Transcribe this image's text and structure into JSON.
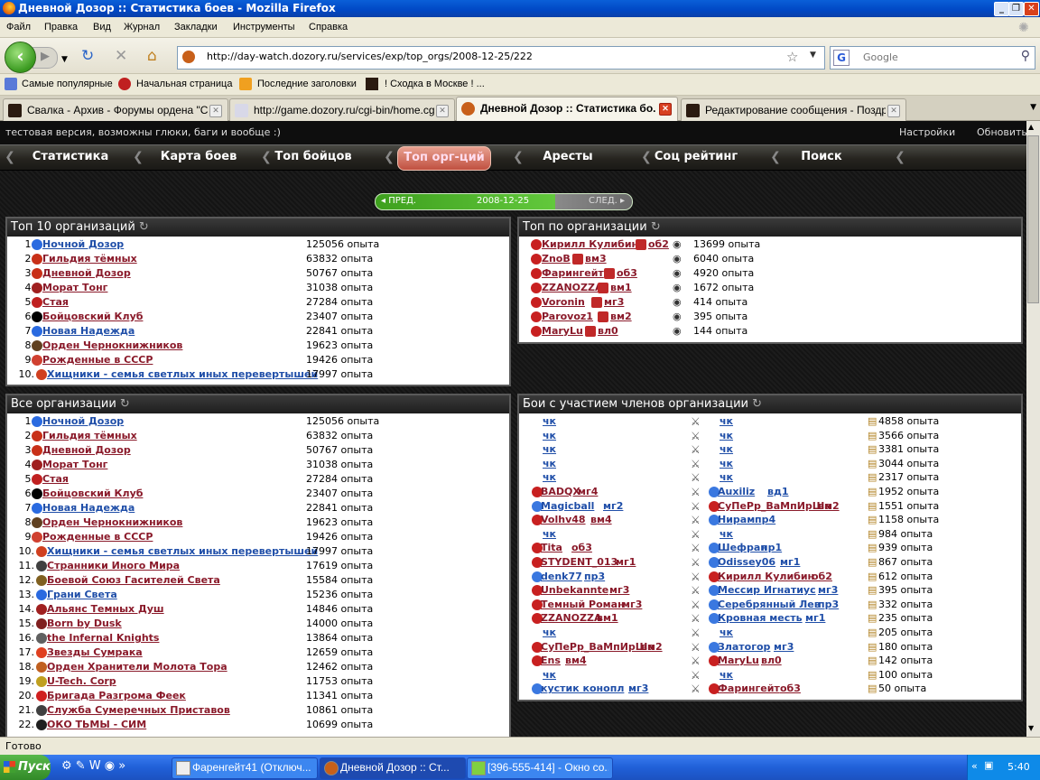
{
  "window": {
    "title": "Дневной Дозор :: Статистика боев - Mozilla Firefox"
  },
  "menu": [
    "Файл",
    "Правка",
    "Вид",
    "Журнал",
    "Закладки",
    "Инструменты",
    "Справка"
  ],
  "toolbar": {
    "url": "http://day-watch.dozory.ru/services/exp/top_orgs/2008-12-25/222",
    "search_placeholder": "Google"
  },
  "bookmarks": [
    "Самые популярные",
    "Начальная страница",
    "Последние заголовки",
    "! Сходка в Москве ! ..."
  ],
  "tabs": [
    {
      "label": "Свалка - Архив - Форумы ордена \"Ст..."
    },
    {
      "label": "http://game.dozory.ru/cgi-bin/home.cgi"
    },
    {
      "label": "Дневной Дозор :: Статистика бо..."
    },
    {
      "label": "Редактирование сообщения - Поздр..."
    }
  ],
  "site": {
    "notice": "тестовая версия, возможны глюки, баги и вообще :)",
    "settings": "Настройки",
    "refresh": "Обновить",
    "menu": [
      "Статистика",
      "Карта боев",
      "Топ бойцов",
      "Топ орг-ций",
      "Аресты",
      "Соц рейтинг",
      "Поиск"
    ],
    "date_nav": {
      "prev": "ПРЕД.",
      "date": "2008-12-25",
      "next": "СЛЕД."
    }
  },
  "top10": {
    "title": "Топ 10 организаций",
    "rows": [
      {
        "n": "1.",
        "name": "Ночной Дозор",
        "exp": "125056 опыта",
        "side": "blue",
        "color": "#2a6ae0"
      },
      {
        "n": "2.",
        "name": "Гильдия тёмных",
        "exp": "63832 опыта",
        "side": "red",
        "color": "#c83018"
      },
      {
        "n": "3.",
        "name": "Дневной Дозор",
        "exp": "50767 опыта",
        "side": "red",
        "color": "#c83018"
      },
      {
        "n": "4.",
        "name": "Морат Тонг",
        "exp": "31038 опыта",
        "side": "red",
        "color": "#a02020"
      },
      {
        "n": "5.",
        "name": "Стая",
        "exp": "27284 опыта",
        "side": "red",
        "color": "#c02020"
      },
      {
        "n": "6.",
        "name": "Бойцовский Клуб",
        "exp": "23407 опыта",
        "side": "red",
        "color": "#000000"
      },
      {
        "n": "7.",
        "name": "Новая Надежда",
        "exp": "22841 опыта",
        "side": "blue",
        "color": "#2a6ae0"
      },
      {
        "n": "8.",
        "name": "Орден Чернокнижников",
        "exp": "19623 опыта",
        "side": "red",
        "color": "#604020"
      },
      {
        "n": "9.",
        "name": "Рожденные в СССР",
        "exp": "19426 опыта",
        "side": "red",
        "color": "#d04030"
      },
      {
        "n": "10.",
        "name": "Хищники - семья светлых иных перевертышей",
        "exp": "17997 опыта",
        "side": "blue",
        "color": "#d04020"
      }
    ]
  },
  "top_by_org": {
    "title": "Топ по организации",
    "rows": [
      {
        "name": "Кирилл Кулибин",
        "lvl": "об2",
        "exp": "13699 опыта"
      },
      {
        "name": "ZnoB",
        "lvl": "вм3",
        "exp": "6040 опыта"
      },
      {
        "name": "Фарингейт",
        "lvl": "об3",
        "exp": "4920 опыта"
      },
      {
        "name": "ZZANOZZA",
        "lvl": "вм1",
        "exp": "1672 опыта"
      },
      {
        "name": "Voronin",
        "lvl": "мг3",
        "exp": "414 опыта"
      },
      {
        "name": "Parovoz1",
        "lvl": "вм2",
        "exp": "395 опыта"
      },
      {
        "name": "MaryLu",
        "lvl": "вл0",
        "exp": "144 опыта"
      }
    ]
  },
  "all_orgs": {
    "title": "Все организации",
    "rows": [
      {
        "n": "1.",
        "name": "Ночной Дозор",
        "exp": "125056 опыта",
        "side": "blue",
        "color": "#2a6ae0"
      },
      {
        "n": "2.",
        "name": "Гильдия тёмных",
        "exp": "63832 опыта",
        "side": "red",
        "color": "#c83018"
      },
      {
        "n": "3.",
        "name": "Дневной Дозор",
        "exp": "50767 опыта",
        "side": "red",
        "color": "#c83018"
      },
      {
        "n": "4.",
        "name": "Морат Тонг",
        "exp": "31038 опыта",
        "side": "red",
        "color": "#a02020"
      },
      {
        "n": "5.",
        "name": "Стая",
        "exp": "27284 опыта",
        "side": "red",
        "color": "#c02020"
      },
      {
        "n": "6.",
        "name": "Бойцовский Клуб",
        "exp": "23407 опыта",
        "side": "red",
        "color": "#000000"
      },
      {
        "n": "7.",
        "name": "Новая Надежда",
        "exp": "22841 опыта",
        "side": "blue",
        "color": "#2a6ae0"
      },
      {
        "n": "8.",
        "name": "Орден Чернокнижников",
        "exp": "19623 опыта",
        "side": "red",
        "color": "#604020"
      },
      {
        "n": "9.",
        "name": "Рожденные в СССР",
        "exp": "19426 опыта",
        "side": "red",
        "color": "#d04030"
      },
      {
        "n": "10.",
        "name": "Хищники - семья светлых иных перевертышей",
        "exp": "17997 опыта",
        "side": "blue",
        "color": "#d04020"
      },
      {
        "n": "11.",
        "name": "Странники Иного Мира",
        "exp": "17619 опыта",
        "side": "red",
        "color": "#404040"
      },
      {
        "n": "12.",
        "name": "Боевой Союз Гасителей Света",
        "exp": "15584 опыта",
        "side": "red",
        "color": "#806020"
      },
      {
        "n": "13.",
        "name": "Грани Света",
        "exp": "15236 опыта",
        "side": "blue",
        "color": "#2a6ae0"
      },
      {
        "n": "14.",
        "name": "Альянс Темных Душ",
        "exp": "14846 опыта",
        "side": "red",
        "color": "#a02020"
      },
      {
        "n": "15.",
        "name": "Born by Dusk",
        "exp": "14000 опыта",
        "side": "red",
        "color": "#802020"
      },
      {
        "n": "16.",
        "name": "the Infernal Knights",
        "exp": "13864 опыта",
        "side": "red",
        "color": "#606060"
      },
      {
        "n": "17.",
        "name": "Звезды Сумрака",
        "exp": "12659 опыта",
        "side": "red",
        "color": "#e04020"
      },
      {
        "n": "18.",
        "name": "Орден Хранители Молота Тора",
        "exp": "12462 опыта",
        "side": "red",
        "color": "#c06020"
      },
      {
        "n": "19.",
        "name": "U-Tech. Corp",
        "exp": "11753 опыта",
        "side": "red",
        "color": "#c0a020"
      },
      {
        "n": "20.",
        "name": "Бригада Разгрома Феек",
        "exp": "11341 опыта",
        "side": "red",
        "color": "#d02020"
      },
      {
        "n": "21.",
        "name": "Служба Сумеречных Приставов",
        "exp": "10861 опыта",
        "side": "red",
        "color": "#404040"
      },
      {
        "n": "22.",
        "name": "ОКО ТЬМЫ - СИМ",
        "exp": "10699 опыта",
        "side": "red",
        "color": "#202020"
      }
    ]
  },
  "battles": {
    "title": "Бои с участием членов организации",
    "rows": [
      {
        "a": "",
        "al": "чк",
        "ab": "",
        "b": "",
        "bl": "чк",
        "bb": "",
        "exp": "4858 опыта"
      },
      {
        "a": "",
        "al": "чк",
        "ab": "",
        "b": "",
        "bl": "чк",
        "bb": "",
        "exp": "3566 опыта"
      },
      {
        "a": "",
        "al": "чк",
        "ab": "",
        "b": "",
        "bl": "чк",
        "bb": "",
        "exp": "3381 опыта"
      },
      {
        "a": "",
        "al": "чк",
        "ab": "",
        "b": "",
        "bl": "чк",
        "bb": "",
        "exp": "3044 опыта"
      },
      {
        "a": "",
        "al": "чк",
        "ab": "",
        "b": "",
        "bl": "чк",
        "bb": "",
        "exp": "2317 опыта"
      },
      {
        "a": "BADQX",
        "al": "мг4",
        "ab": "red",
        "b": "Auxiliz",
        "bl": "вд1",
        "bb": "blue",
        "exp": "1952 опыта"
      },
      {
        "a": "Magicball",
        "al": "мг2",
        "ab": "blue",
        "b": "СуПеРр_ВаМпИрШа",
        "bl": "вм2",
        "bb": "red",
        "exp": "1551 опыта"
      },
      {
        "a": "Volhv48",
        "al": "вм4",
        "ab": "red",
        "b": "Нирам",
        "bl": "пр4",
        "bb": "blue",
        "exp": "1158 опыта"
      },
      {
        "a": "",
        "al": "чк",
        "ab": "",
        "b": "",
        "bl": "чк",
        "bb": "",
        "exp": "984 опыта"
      },
      {
        "a": "Tita",
        "al": "об3",
        "ab": "red",
        "b": "Шефран",
        "bl": "пр1",
        "bb": "blue",
        "exp": "939 опыта"
      },
      {
        "a": "STYDENT_013",
        "al": "мг1",
        "ab": "red",
        "b": "Odissey06",
        "bl": "мг1",
        "bb": "blue",
        "exp": "867 опыта"
      },
      {
        "a": "denk77",
        "al": "пр3",
        "ab": "blue",
        "b": "Кирилл Кулибин",
        "bl": "об2",
        "bb": "red",
        "exp": "612 опыта"
      },
      {
        "a": "Unbekannte",
        "al": "мг3",
        "ab": "red",
        "b": "Мессир Игнатиус",
        "bl": "мг3",
        "bb": "blue",
        "exp": "395 опыта"
      },
      {
        "a": "Темный Роман",
        "al": "мг3",
        "ab": "red",
        "b": "Серебрянный Лев",
        "bl": "пр3",
        "bb": "blue",
        "exp": "332 опыта"
      },
      {
        "a": "ZZANOZZA",
        "al": "вм1",
        "ab": "red",
        "b": "Кровная месть",
        "bl": "мг1",
        "bb": "blue",
        "exp": "235 опыта"
      },
      {
        "a": "",
        "al": "чк",
        "ab": "",
        "b": "",
        "bl": "чк",
        "bb": "",
        "exp": "205 опыта"
      },
      {
        "a": "СуПеРр_ВаМпИрШа",
        "al": "вм2",
        "ab": "red",
        "b": "Златогор",
        "bl": "мг3",
        "bb": "blue",
        "exp": "180 опыта"
      },
      {
        "a": "Ens",
        "al": "вм4",
        "ab": "red",
        "b": "MaryLu",
        "bl": "вл0",
        "bb": "red",
        "exp": "142 опыта"
      },
      {
        "a": "",
        "al": "чк",
        "ab": "",
        "b": "",
        "bl": "чк",
        "bb": "",
        "exp": "100 опыта"
      },
      {
        "a": "кустик конопл",
        "al": "мг3",
        "ab": "blue",
        "b": "Фарингейт",
        "bl": "об3",
        "bb": "red",
        "exp": "50 опыта"
      }
    ]
  },
  "status": {
    "text": "Готово"
  },
  "taskbar": {
    "start": "Пуск",
    "tasks": [
      "Фаренгейт41 (Отключ...",
      "Дневной Дозор :: Ст...",
      "[396-555-414] - Окно со..."
    ],
    "clock": "5:40"
  }
}
